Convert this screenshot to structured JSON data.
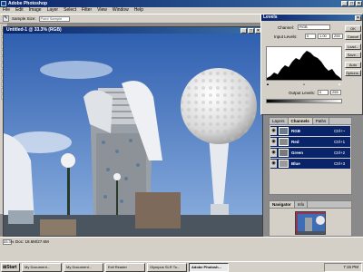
{
  "app": {
    "title": "Adobe Photoshop",
    "menus": [
      "File",
      "Edit",
      "Image",
      "Layer",
      "Select",
      "Filter",
      "View",
      "Window",
      "Help"
    ]
  },
  "options_bar": {
    "tool_icon": "eyedropper-icon",
    "sample_label": "Sample Size:",
    "sample_value": "Point Sample"
  },
  "document": {
    "title": "Untitled-1 @ 33.3% (RGB)",
    "zoom": "33.3%",
    "doc_size": "Doc: 18.6M/27.6M"
  },
  "levels": {
    "title": "Levels",
    "channel_label": "Channel:",
    "channel_value": "RGB",
    "input_label": "Input Levels:",
    "input_values": [
      "0",
      "1.00",
      "255"
    ],
    "output_label": "Output Levels:",
    "output_values": [
      "0",
      "255"
    ],
    "buttons": [
      "OK",
      "Cancel",
      "Load...",
      "Save...",
      "Auto",
      "Options..."
    ]
  },
  "channels_palette": {
    "tabs": [
      "Layers",
      "Channels",
      "Paths"
    ],
    "active_tab": "Channels",
    "channels": [
      {
        "name": "RGB",
        "shortcut": "Ctrl+~",
        "thumb_color": "#6c7c8c"
      },
      {
        "name": "Red",
        "shortcut": "Ctrl+1",
        "thumb_color": "#8a8a8a"
      },
      {
        "name": "Green",
        "shortcut": "Ctrl+2",
        "thumb_color": "#7a7a7a"
      },
      {
        "name": "Blue",
        "shortcut": "Ctrl+3",
        "thumb_color": "#9a9a9a"
      }
    ]
  },
  "navigator": {
    "tabs": [
      "Navigator",
      "Info"
    ]
  },
  "taskbar": {
    "start": "Start",
    "items": [
      "My Document...",
      "My Document...",
      "Exif Reader",
      "Olympus SLR To...",
      "Adobe Photosh..."
    ],
    "active_index": 4,
    "clock": "7:15 PM"
  },
  "colors": {
    "title_blue": "#0a246a",
    "sky": "#3f6db5",
    "window_gray": "#d4d0c8"
  }
}
